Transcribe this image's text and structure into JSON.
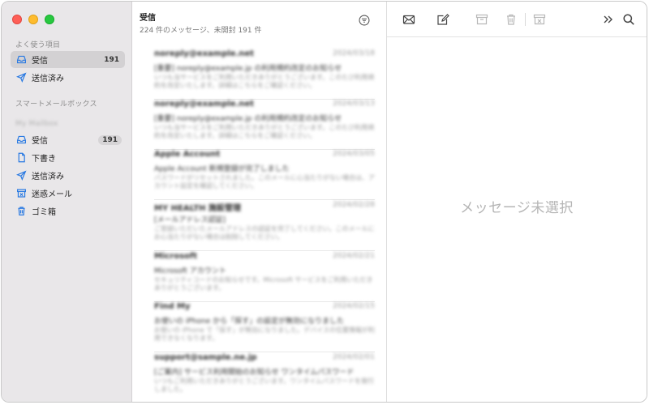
{
  "sidebar": {
    "favorites_title": "よく使う項目",
    "favorites": [
      {
        "label": "受信",
        "count": "191",
        "icon": "inbox-icon"
      },
      {
        "label": "送信済み",
        "count": "",
        "icon": "paperplane-icon"
      }
    ],
    "smart_title": "スマートメールボックス",
    "account_title": "My Mailbox",
    "account_items": [
      {
        "label": "受信",
        "count": "191",
        "icon": "inbox-icon"
      },
      {
        "label": "下書き",
        "count": "",
        "icon": "document-icon"
      },
      {
        "label": "送信済み",
        "count": "",
        "icon": "paperplane-icon"
      },
      {
        "label": "迷惑メール",
        "count": "",
        "icon": "junk-icon"
      },
      {
        "label": "ゴミ箱",
        "count": "",
        "icon": "trash-icon"
      }
    ]
  },
  "list": {
    "title": "受信",
    "subtitle": "224 件のメッセージ、未開封 191 件",
    "messages": [
      {
        "sender": "noreply@example.net",
        "date": "2024/03/18",
        "subject": "[重要] noreply@example.jp の利用規約改定のお知らせ",
        "preview": "いつも当サービスをご利用いただきありがとうございます。このたび利用規約を改定いたします。詳細はこちらをご確認ください。"
      },
      {
        "sender": "noreply@example.net",
        "date": "2024/03/13",
        "subject": "[重要] noreply@example.jp の利用規約改定のお知らせ",
        "preview": "いつも当サービスをご利用いただきありがとうございます。このたび利用規約を改定いたします。詳細はこちらをご確認ください。"
      },
      {
        "sender": "Apple Account",
        "date": "2024/03/05",
        "subject": "Apple Account 新規登録が完了しました",
        "preview": "パスワードがリセットされました。このメールに心当たりがない場合は、アカウント設定を確認してください。"
      },
      {
        "sender": "MY HEALTH 施設管理",
        "date": "2024/02/28",
        "subject": "[メールアドレス認証]",
        "preview": "ご登録いただいたメールアドレスの認証を完了してください。このメールにお心当たりがない場合は削除してください。"
      },
      {
        "sender": "Microsoft",
        "date": "2024/02/21",
        "subject": "Microsoft アカウント",
        "preview": "セキュリティコードのお知らせです。Microsoft サービスをご利用いただきありがとうございます。"
      },
      {
        "sender": "Find My",
        "date": "2024/02/15",
        "subject": "お使いの iPhone から「探す」の設定が無効になりました",
        "preview": "お使いの iPhone で「探す」が無効になりました。デバイスの位置情報が利用できなくなります。"
      },
      {
        "sender": "support@sample.ne.jp",
        "date": "2024/02/01",
        "subject": "[ご案内] サービス利用開始のお知らせ ワンタイムパスワード",
        "preview": "いつもご利用いただきありがとうございます。ワンタイムパスワードを発行しました。"
      }
    ]
  },
  "viewer": {
    "empty_label": "メッセージ未選択",
    "toolbar_icons": [
      "new-message-icon",
      "compose-icon",
      "archive-icon",
      "trash-icon",
      "junk-icon",
      "more-chevrons-icon",
      "search-icon"
    ]
  }
}
